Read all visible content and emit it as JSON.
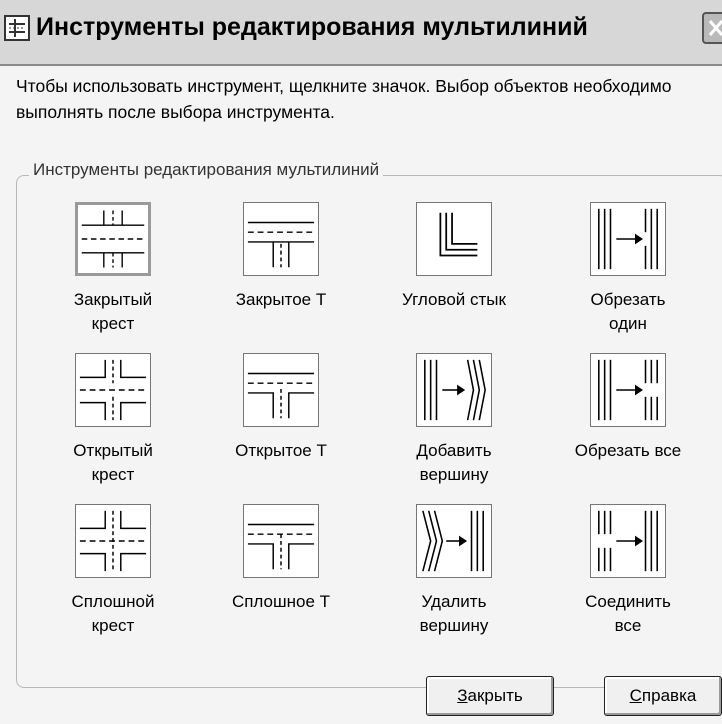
{
  "window": {
    "title": "Инструменты редактирования мультилиний",
    "title_icon": "app-icon",
    "close_icon": "close-icon"
  },
  "instructions": "Чтобы использовать инструмент, щелкните значок.  Выбор объектов необходимо выполнять после выбора инструмента.",
  "group": {
    "label": "Инструменты редактирования мультилиний",
    "tools": [
      {
        "label_1": "Закрытый",
        "label_2": "крест",
        "icon": "closed-cross-icon",
        "selected": true
      },
      {
        "label_1": "Закрытое Т",
        "label_2": "",
        "icon": "closed-tee-icon"
      },
      {
        "label_1": "Угловой стык",
        "label_2": "",
        "icon": "corner-joint-icon"
      },
      {
        "label_1": "Обрезать",
        "label_2": "один",
        "icon": "cut-single-icon"
      },
      {
        "label_1": "Открытый",
        "label_2": "крест",
        "icon": "open-cross-icon"
      },
      {
        "label_1": "Открытое Т",
        "label_2": "",
        "icon": "open-tee-icon"
      },
      {
        "label_1": "Добавить",
        "label_2": "вершину",
        "icon": "add-vertex-icon"
      },
      {
        "label_1": "Обрезать все",
        "label_2": "",
        "icon": "cut-all-icon"
      },
      {
        "label_1": "Сплошной",
        "label_2": "крест",
        "icon": "merged-cross-icon"
      },
      {
        "label_1": "Сплошное Т",
        "label_2": "",
        "icon": "merged-tee-icon"
      },
      {
        "label_1": "Удалить",
        "label_2": "вершину",
        "icon": "delete-vertex-icon"
      },
      {
        "label_1": "Соединить",
        "label_2": "все",
        "icon": "weld-all-icon"
      }
    ]
  },
  "buttons": {
    "close_accel": "З",
    "close_rest": "акрыть",
    "help_accel": "С",
    "help_rest": "правка"
  }
}
